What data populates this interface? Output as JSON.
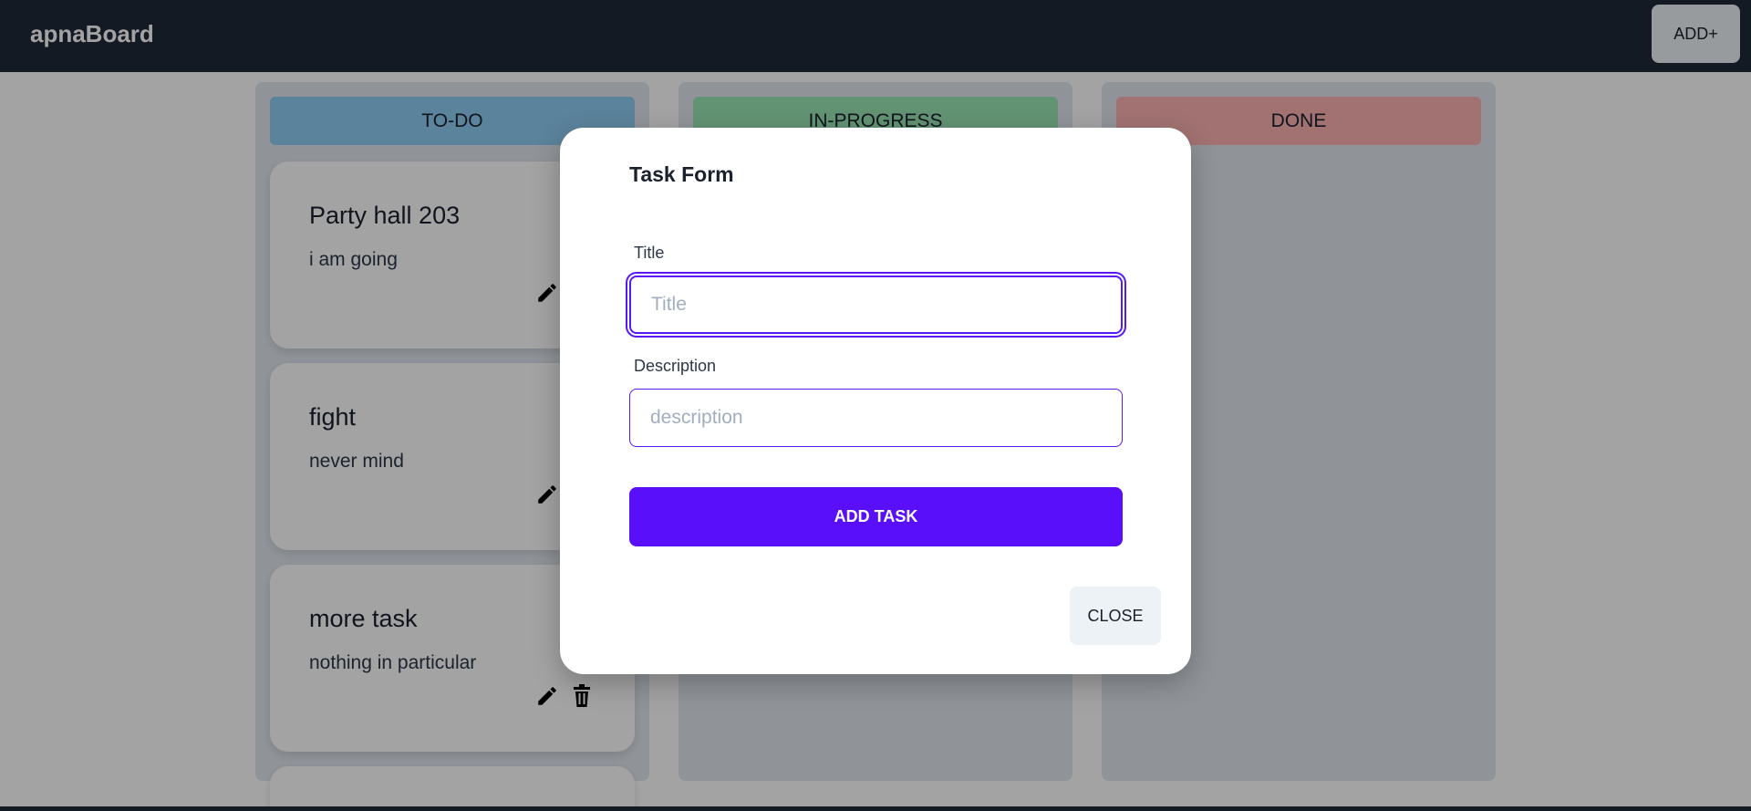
{
  "navbar": {
    "brand": "apnaBoard",
    "add_label": "ADD+"
  },
  "columns": [
    {
      "label": "TO-DO",
      "color": "#90cdf4"
    },
    {
      "label": "IN-PROGRESS",
      "color": "#9ae6b4"
    },
    {
      "label": "DONE",
      "color": "#feb2b2"
    }
  ],
  "tasks": [
    {
      "title": "Party hall 203",
      "description": "i am going"
    },
    {
      "title": "fight",
      "description": "never mind"
    },
    {
      "title": "more task",
      "description": "nothing in particular"
    }
  ],
  "icons": {
    "edit": "pencil-icon",
    "delete": "trash-icon"
  },
  "modal": {
    "heading": "Task Form",
    "title_label": "Title",
    "title_placeholder": "Title",
    "description_label": "Description",
    "description_placeholder": "description",
    "submit_label": "ADD TASK",
    "close_label": "CLOSE"
  },
  "colors": {
    "navbar": "#1f2937",
    "accent": "#5a0ffa"
  }
}
